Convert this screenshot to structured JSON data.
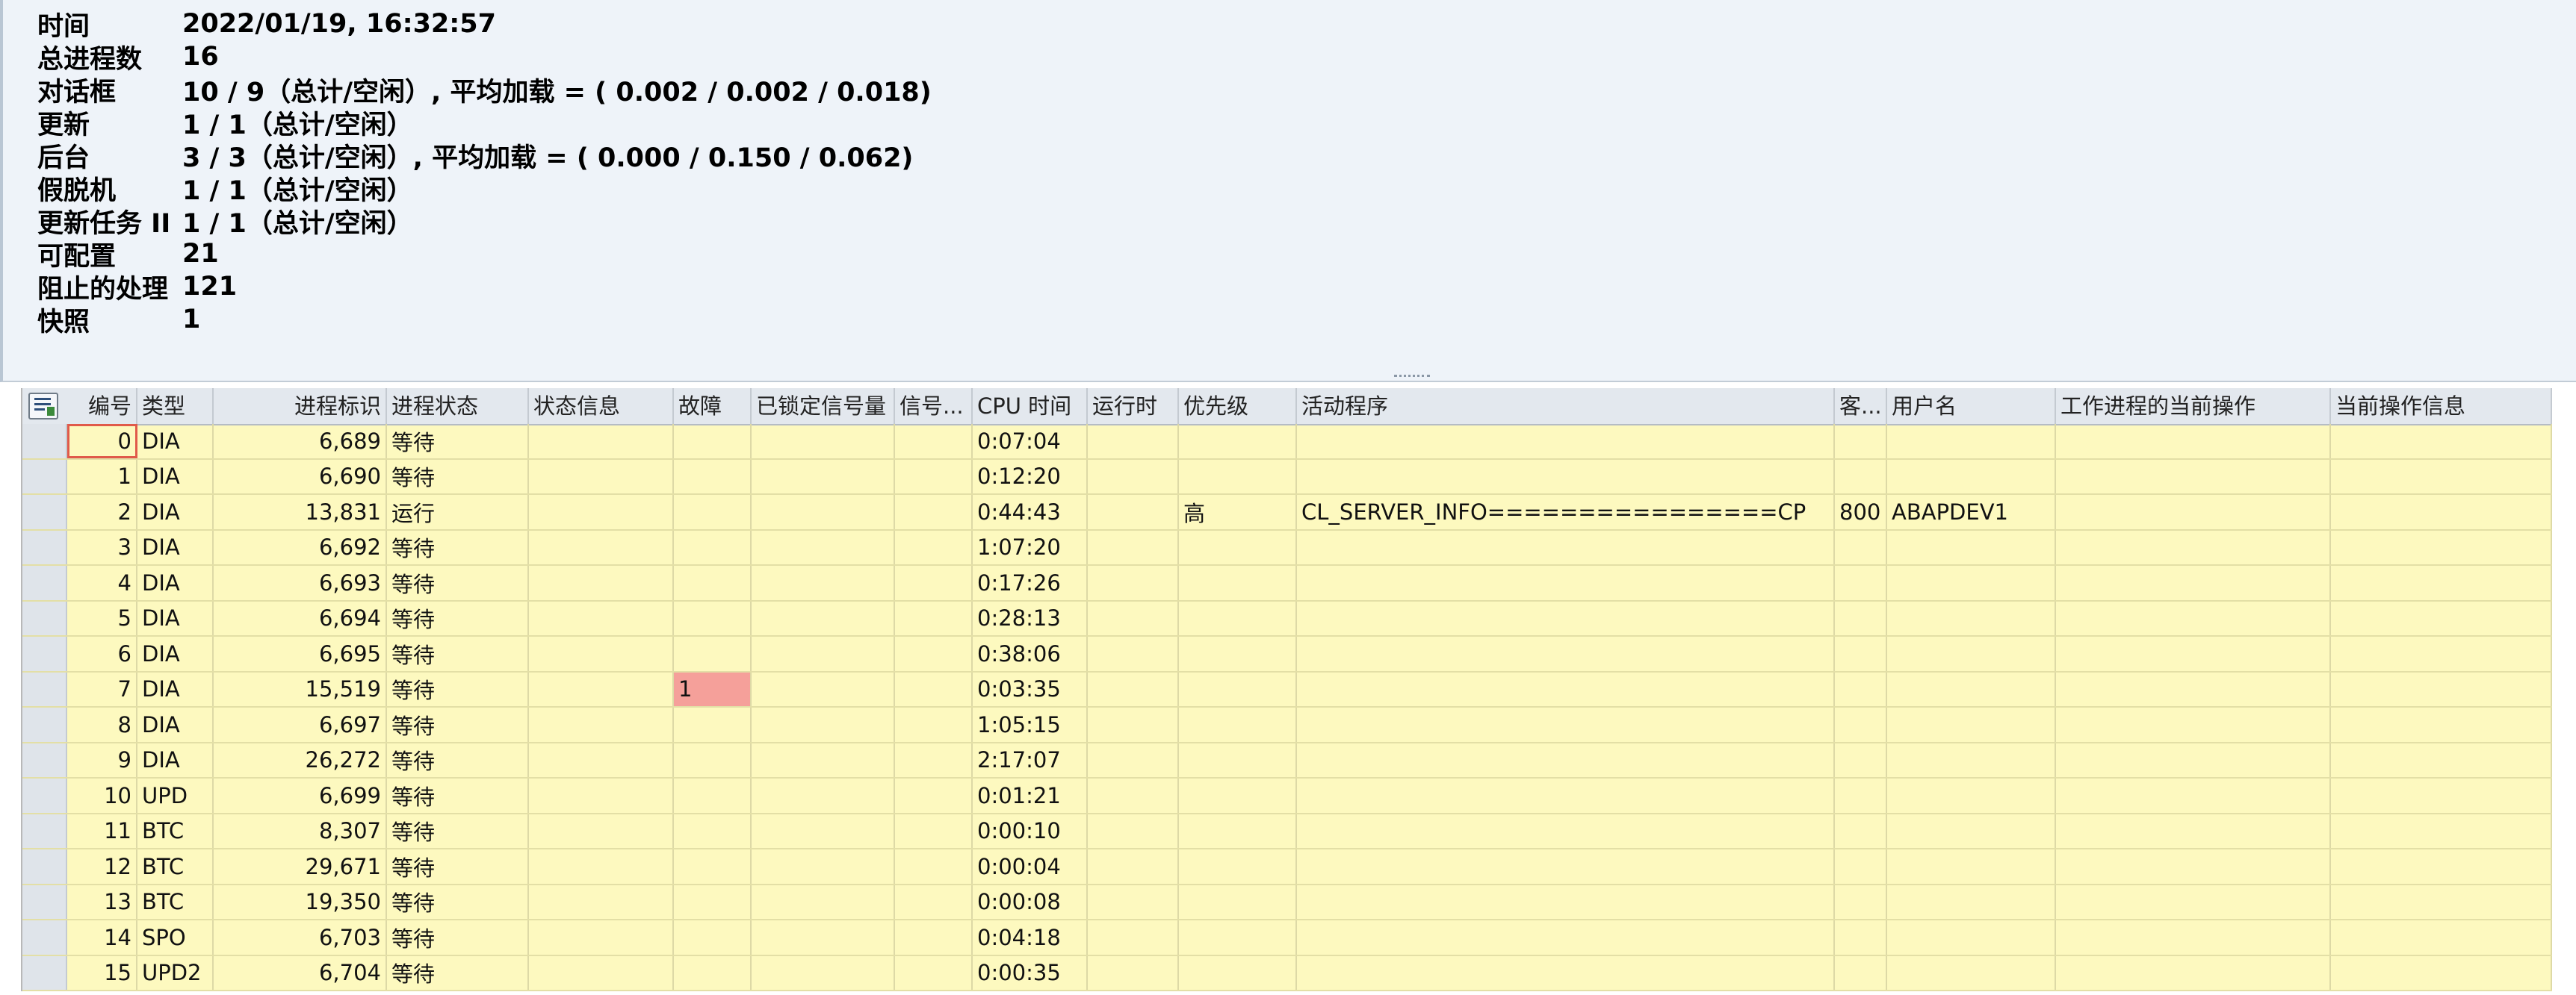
{
  "summary": {
    "rows": [
      {
        "label": "时间",
        "value": "2022/01/19, 16:32:57"
      },
      {
        "label": "总进程数",
        "value": "16"
      },
      {
        "label": "对话框",
        "value": "10 / 9（总计/空闲）, 平均加载 = ( 0.002 / 0.002 / 0.018)"
      },
      {
        "label": "更新",
        "value": "1 / 1（总计/空闲）"
      },
      {
        "label": "后台",
        "value": "3 / 3（总计/空闲）, 平均加载 = ( 0.000 / 0.150 / 0.062)"
      },
      {
        "label": "假脱机",
        "value": "1 / 1（总计/空闲）"
      },
      {
        "label": "更新任务 II",
        "value": "1 / 1（总计/空闲）"
      },
      {
        "label": "可配置",
        "value": "21"
      },
      {
        "label": "阻止的处理",
        "value": "121"
      },
      {
        "label": "快照",
        "value": "1"
      }
    ]
  },
  "grid": {
    "columns": [
      {
        "key": "no",
        "label": "编号"
      },
      {
        "key": "type",
        "label": "类型"
      },
      {
        "key": "pid",
        "label": "进程标识"
      },
      {
        "key": "status",
        "label": "进程状态"
      },
      {
        "key": "statusinfo",
        "label": "状态信息"
      },
      {
        "key": "err",
        "label": "故障"
      },
      {
        "key": "sem",
        "label": "已锁定信号量"
      },
      {
        "key": "sig",
        "label": "信号..."
      },
      {
        "key": "cpu",
        "label": "CPU 时间"
      },
      {
        "key": "runtime",
        "label": "运行时"
      },
      {
        "key": "prio",
        "label": "优先级"
      },
      {
        "key": "program",
        "label": "活动程序"
      },
      {
        "key": "client",
        "label": "客..."
      },
      {
        "key": "user",
        "label": "用户名"
      },
      {
        "key": "action",
        "label": "工作进程的当前操作"
      },
      {
        "key": "actioninfo",
        "label": "当前操作信息"
      }
    ],
    "rows": [
      {
        "no": "0",
        "type": "DIA",
        "pid": "6,689",
        "status": "等待",
        "statusinfo": "",
        "err": "",
        "sem": "",
        "sig": "",
        "cpu": "0:07:04",
        "runtime": "",
        "prio": "",
        "program": "",
        "client": "",
        "user": "",
        "action": "",
        "actioninfo": ""
      },
      {
        "no": "1",
        "type": "DIA",
        "pid": "6,690",
        "status": "等待",
        "statusinfo": "",
        "err": "",
        "sem": "",
        "sig": "",
        "cpu": "0:12:20",
        "runtime": "",
        "prio": "",
        "program": "",
        "client": "",
        "user": "",
        "action": "",
        "actioninfo": ""
      },
      {
        "no": "2",
        "type": "DIA",
        "pid": "13,831",
        "status": "运行",
        "statusinfo": "",
        "err": "",
        "sem": "",
        "sig": "",
        "cpu": "0:44:43",
        "runtime": "",
        "prio": "高",
        "program": "CL_SERVER_INFO================CP",
        "client": "800",
        "user": "ABAPDEV1",
        "action": "",
        "actioninfo": ""
      },
      {
        "no": "3",
        "type": "DIA",
        "pid": "6,692",
        "status": "等待",
        "statusinfo": "",
        "err": "",
        "sem": "",
        "sig": "",
        "cpu": "1:07:20",
        "runtime": "",
        "prio": "",
        "program": "",
        "client": "",
        "user": "",
        "action": "",
        "actioninfo": ""
      },
      {
        "no": "4",
        "type": "DIA",
        "pid": "6,693",
        "status": "等待",
        "statusinfo": "",
        "err": "",
        "sem": "",
        "sig": "",
        "cpu": "0:17:26",
        "runtime": "",
        "prio": "",
        "program": "",
        "client": "",
        "user": "",
        "action": "",
        "actioninfo": ""
      },
      {
        "no": "5",
        "type": "DIA",
        "pid": "6,694",
        "status": "等待",
        "statusinfo": "",
        "err": "",
        "sem": "",
        "sig": "",
        "cpu": "0:28:13",
        "runtime": "",
        "prio": "",
        "program": "",
        "client": "",
        "user": "",
        "action": "",
        "actioninfo": ""
      },
      {
        "no": "6",
        "type": "DIA",
        "pid": "6,695",
        "status": "等待",
        "statusinfo": "",
        "err": "",
        "sem": "",
        "sig": "",
        "cpu": "0:38:06",
        "runtime": "",
        "prio": "",
        "program": "",
        "client": "",
        "user": "",
        "action": "",
        "actioninfo": ""
      },
      {
        "no": "7",
        "type": "DIA",
        "pid": "15,519",
        "status": "等待",
        "statusinfo": "",
        "err": "1",
        "sem": "",
        "sig": "",
        "cpu": "0:03:35",
        "runtime": "",
        "prio": "",
        "program": "",
        "client": "",
        "user": "",
        "action": "",
        "actioninfo": ""
      },
      {
        "no": "8",
        "type": "DIA",
        "pid": "6,697",
        "status": "等待",
        "statusinfo": "",
        "err": "",
        "sem": "",
        "sig": "",
        "cpu": "1:05:15",
        "runtime": "",
        "prio": "",
        "program": "",
        "client": "",
        "user": "",
        "action": "",
        "actioninfo": ""
      },
      {
        "no": "9",
        "type": "DIA",
        "pid": "26,272",
        "status": "等待",
        "statusinfo": "",
        "err": "",
        "sem": "",
        "sig": "",
        "cpu": "2:17:07",
        "runtime": "",
        "prio": "",
        "program": "",
        "client": "",
        "user": "",
        "action": "",
        "actioninfo": ""
      },
      {
        "no": "10",
        "type": "UPD",
        "pid": "6,699",
        "status": "等待",
        "statusinfo": "",
        "err": "",
        "sem": "",
        "sig": "",
        "cpu": "0:01:21",
        "runtime": "",
        "prio": "",
        "program": "",
        "client": "",
        "user": "",
        "action": "",
        "actioninfo": ""
      },
      {
        "no": "11",
        "type": "BTC",
        "pid": "8,307",
        "status": "等待",
        "statusinfo": "",
        "err": "",
        "sem": "",
        "sig": "",
        "cpu": "0:00:10",
        "runtime": "",
        "prio": "",
        "program": "",
        "client": "",
        "user": "",
        "action": "",
        "actioninfo": ""
      },
      {
        "no": "12",
        "type": "BTC",
        "pid": "29,671",
        "status": "等待",
        "statusinfo": "",
        "err": "",
        "sem": "",
        "sig": "",
        "cpu": "0:00:04",
        "runtime": "",
        "prio": "",
        "program": "",
        "client": "",
        "user": "",
        "action": "",
        "actioninfo": ""
      },
      {
        "no": "13",
        "type": "BTC",
        "pid": "19,350",
        "status": "等待",
        "statusinfo": "",
        "err": "",
        "sem": "",
        "sig": "",
        "cpu": "0:00:08",
        "runtime": "",
        "prio": "",
        "program": "",
        "client": "",
        "user": "",
        "action": "",
        "actioninfo": ""
      },
      {
        "no": "14",
        "type": "SPO",
        "pid": "6,703",
        "status": "等待",
        "statusinfo": "",
        "err": "",
        "sem": "",
        "sig": "",
        "cpu": "0:04:18",
        "runtime": "",
        "prio": "",
        "program": "",
        "client": "",
        "user": "",
        "action": "",
        "actioninfo": ""
      },
      {
        "no": "15",
        "type": "UPD2",
        "pid": "6,704",
        "status": "等待",
        "statusinfo": "",
        "err": "",
        "sem": "",
        "sig": "",
        "cpu": "0:00:35",
        "runtime": "",
        "prio": "",
        "program": "",
        "client": "",
        "user": "",
        "action": "",
        "actioninfo": ""
      }
    ],
    "colors": {
      "grid_bg": "#fdf9bf",
      "error_cell": "#f5a09a",
      "header_bg": "#e3e8ee"
    },
    "icons": {
      "layout_button": "layout-settings-icon"
    }
  }
}
